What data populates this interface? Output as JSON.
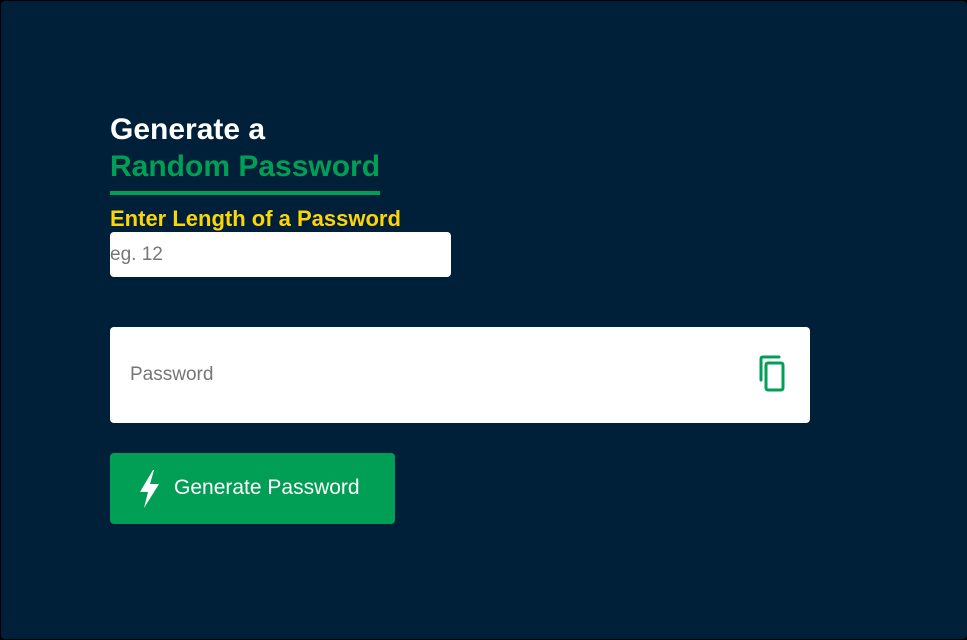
{
  "heading": {
    "line1": "Generate a",
    "line2": "Random Password"
  },
  "length_field": {
    "label": "Enter Length of a Password",
    "placeholder": "eg. 12",
    "value": ""
  },
  "password_field": {
    "placeholder": "Password",
    "value": "",
    "copy_icon": "copy-icon"
  },
  "generate_button": {
    "label": "Generate Password",
    "icon": "lightning-bolt-icon"
  },
  "colors": {
    "background": "#00203a",
    "accent_green": "#019f55",
    "label_yellow": "#fbd40a",
    "text_white": "#ffffff"
  }
}
